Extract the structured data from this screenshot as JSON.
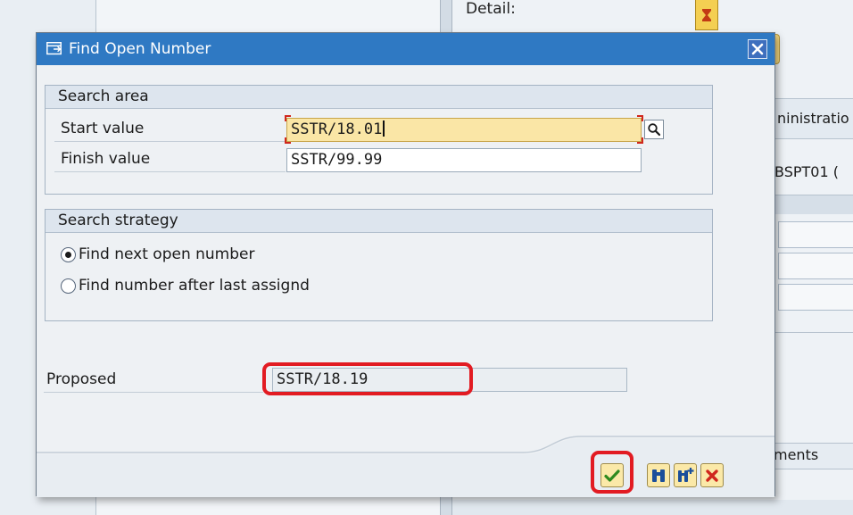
{
  "background": {
    "detail_label": "Detail:",
    "tab_header_text": "ninistratio",
    "partial_text": "BSPT01 (",
    "ments_text": "ments"
  },
  "dialog": {
    "title": "Find Open Number",
    "title_icon": "window-popup-icon",
    "close_icon": "close-icon",
    "search_area": {
      "title": "Search area",
      "start_label": "Start value",
      "start_value": "SSTR/18.01",
      "finish_label": "Finish value",
      "finish_value": "SSTR/99.99"
    },
    "search_strategy": {
      "title": "Search strategy",
      "options": [
        {
          "label": "Find next open number",
          "selected": true
        },
        {
          "label": "Find number after last assignd",
          "selected": false
        }
      ]
    },
    "proposed": {
      "label": "Proposed",
      "value": "SSTR/18.19"
    },
    "toolbar": {
      "buttons": [
        {
          "name": "continue-button",
          "icon": "checkmark-icon"
        },
        {
          "name": "find-button",
          "icon": "binoculars-icon"
        },
        {
          "name": "find-next-button",
          "icon": "binoculars-plus-icon"
        },
        {
          "name": "cancel-button",
          "icon": "cancel-x-icon"
        }
      ]
    },
    "colors": {
      "titlebar": "#2f79c3",
      "focused_field": "#fae6a6",
      "highlight": "#e21b22",
      "toolbar_button": "#fbe9a8"
    }
  }
}
